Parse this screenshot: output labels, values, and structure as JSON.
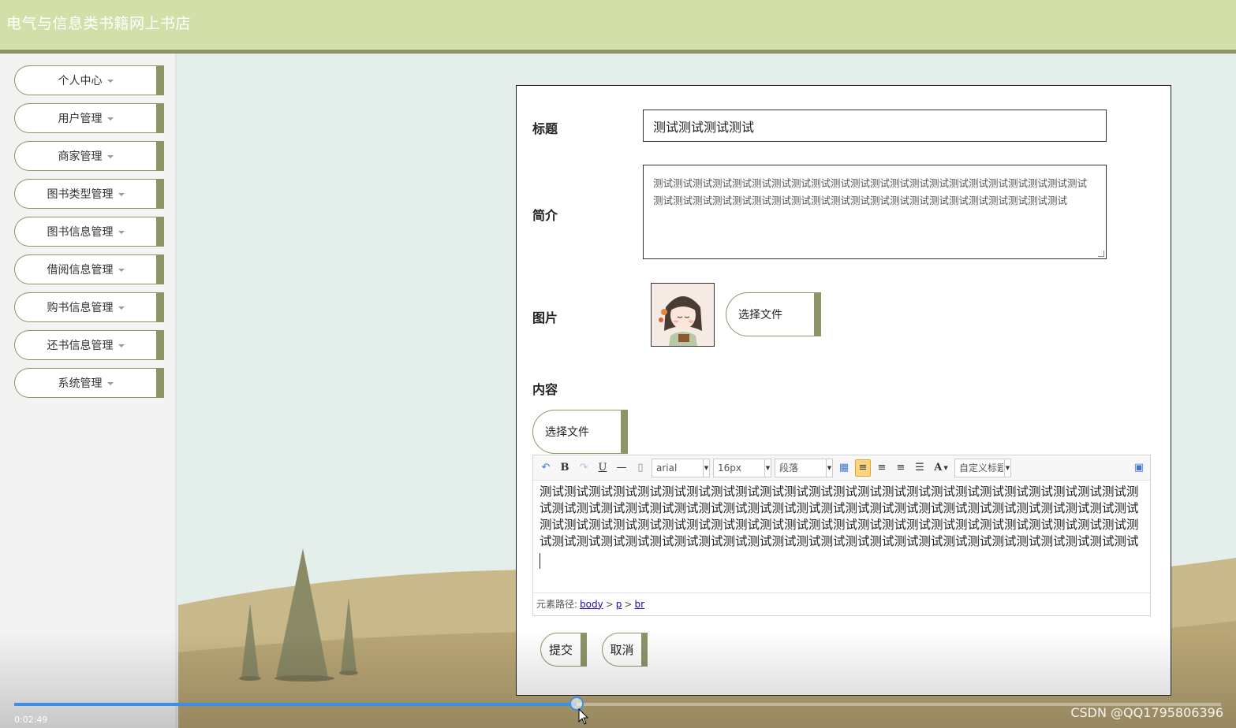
{
  "header": {
    "title": "电气与信息类书籍网上书店"
  },
  "sidebar": {
    "items": [
      {
        "label": "个人中心"
      },
      {
        "label": "用户管理"
      },
      {
        "label": "商家管理"
      },
      {
        "label": "图书类型管理"
      },
      {
        "label": "图书信息管理"
      },
      {
        "label": "借阅信息管理"
      },
      {
        "label": "购书信息管理"
      },
      {
        "label": "还书信息管理"
      },
      {
        "label": "系统管理"
      }
    ]
  },
  "form": {
    "title_label": "标题",
    "title_value": "测试测试测试测试",
    "summary_label": "简介",
    "summary_value": "测试测试测试测试测试测试测试测试测试测试测试测试测试测试测试测试测试测试测试测试测试测试测试测试测试测试测试测试测试测试测试测试测试测试测试测试测试测试测试测试测试测试测试",
    "image_label": "图片",
    "choose_file_label": "选择文件",
    "content_label": "内容",
    "content_choose_file_label": "选择文件",
    "submit_label": "提交",
    "cancel_label": "取消"
  },
  "editor": {
    "font_family": "arial",
    "font_size": "16px",
    "paragraph": "段落",
    "custom_heading": "自定义标题",
    "body_text": "测试测试测试测试测试测试测试测试测试测试测试测试测试测试测试测试测试测试测试测试测试测试测试测试测试测试测试测试测试测试测试测试测试测试测试测试测试测试测试测试测试测试测试测试测试测试测试测试测试测试测试测试测试测试测试测试测试测试测试测试测试测试测试测试测试测试测试测试测试测试测试测试测试测试测试测试测试测试测试测试测试测试测试测试测试测试测试测试测试测试测试测试测试测试测试测试测试测试",
    "path_label": "元素路径:",
    "path": [
      "body",
      "p",
      "br"
    ]
  },
  "video": {
    "time": "0:02:49",
    "progress_fraction": 0.466,
    "progress_color": "#3d8fe6"
  },
  "watermark": "CSDN @QQ1795806396",
  "colors": {
    "header_bg": "#d2dfa8",
    "accent": "#8c9468",
    "background": "#e4efeb"
  }
}
